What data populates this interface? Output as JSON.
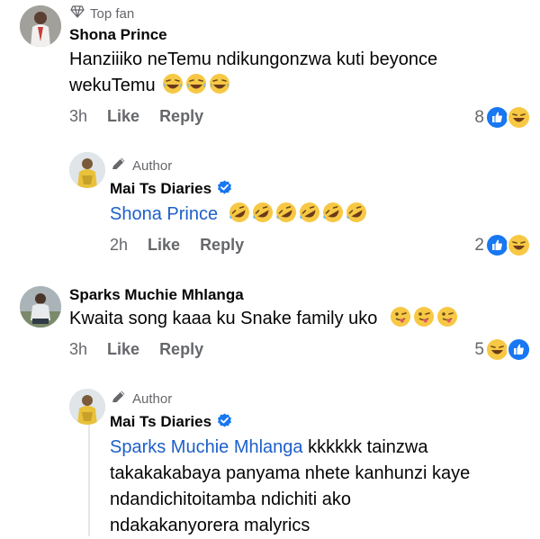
{
  "comments": [
    {
      "badge": "Top fan",
      "badge_icon": "diamond-icon",
      "name": "Shona Prince",
      "text_line1": "Hanziiiko neTemu ndikungonzwa kuti beyonce",
      "text_line2": "wekuTemu",
      "emojis": [
        "laughing-face",
        "laughing-face",
        "laughing-face"
      ],
      "time": "3h",
      "like_label": "Like",
      "reply_label": "Reply",
      "reaction_count": "8",
      "reactions": [
        "like",
        "haha"
      ]
    },
    {
      "badge": "Author",
      "badge_icon": "pen-icon",
      "name": "Mai Ts Diaries",
      "verified": true,
      "mention": "Shona Prince",
      "emojis": [
        "rofl-face",
        "rofl-face",
        "rofl-face",
        "rofl-face",
        "rofl-face",
        "rofl-face"
      ],
      "time": "2h",
      "like_label": "Like",
      "reply_label": "Reply",
      "reaction_count": "2",
      "reactions": [
        "like",
        "haha"
      ]
    },
    {
      "name": "Sparks Muchie Mhlanga",
      "text": "Kwaita song kaaa ku Snake family uko",
      "emojis": [
        "winking-tongue-face",
        "winking-tongue-face",
        "winking-tongue-face"
      ],
      "time": "3h",
      "like_label": "Like",
      "reply_label": "Reply",
      "reaction_count": "5",
      "reactions": [
        "haha",
        "like"
      ]
    },
    {
      "badge": "Author",
      "badge_icon": "pen-icon",
      "name": "Mai Ts Diaries",
      "verified": true,
      "mention": "Sparks Muchie Mhlanga",
      "text_line1_rest": " kkkkkk tainzwa",
      "text_line2": "takakakabaya panyama nhete kanhunzi kaye",
      "text_line3": "ndandichitoitamba ndichiti ako",
      "text_line4": "ndakakanyorera malyrics"
    }
  ],
  "colors": {
    "link": "#1d5fc9",
    "like_blue": "#1877f2",
    "meta_gray": "#65676b",
    "verified_blue": "#1877f2"
  }
}
